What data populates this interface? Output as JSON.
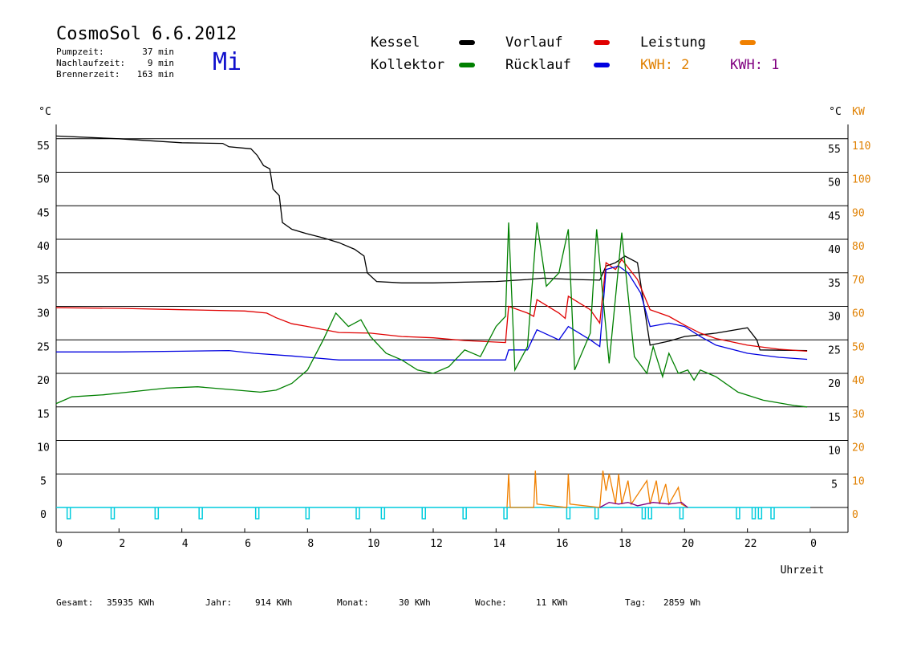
{
  "header": {
    "title": "CosmoSol 6.6.2012",
    "day": "Mi",
    "stats": [
      {
        "label": "Pumpzeit:",
        "value": "37 min"
      },
      {
        "label": "Nachlaufzeit:",
        "value": "9 min"
      },
      {
        "label": "Brennerzeit:",
        "value": "163 min"
      }
    ]
  },
  "legend": {
    "kessel": {
      "label": "Kessel",
      "color": "#000000"
    },
    "vorlauf": {
      "label": "Vorlauf",
      "color": "#e00000"
    },
    "leistung": {
      "label": "Leistung",
      "color": "#f08000"
    },
    "kollektor": {
      "label": "Kollektor",
      "color": "#008000"
    },
    "ruecklauf": {
      "label": "Rücklauf",
      "color": "#0000e0"
    },
    "kwh1": {
      "label": "KWH: 2",
      "color": "#e08000"
    },
    "kwh2": {
      "label": "KWH: 1",
      "color": "#800080"
    }
  },
  "footer": {
    "gesamt_label": "Gesamt:",
    "gesamt_value": "35935 KWh",
    "jahr_label": "Jahr:",
    "jahr_value": "914 KWh",
    "monat_label": "Monat:",
    "monat_value": "30 KWh",
    "woche_label": "Woche:",
    "woche_value": "11 KWh",
    "tag_label": "Tag:",
    "tag_value": "2859 Wh"
  },
  "chart_data": {
    "type": "line",
    "xlabel": "Uhrzeit",
    "ylabel_left": "°C",
    "ylabel_right_temp": "°C",
    "ylabel_right_power": "KW",
    "xlim": [
      0,
      24
    ],
    "ylim": [
      0,
      55
    ],
    "x_ticks": [
      0,
      2,
      4,
      6,
      8,
      10,
      12,
      14,
      16,
      18,
      20,
      22,
      24
    ],
    "x_tick_labels": [
      "0",
      "2",
      "4",
      "6",
      "8",
      "10",
      "12",
      "14",
      "16",
      "18",
      "20",
      "22",
      "0"
    ],
    "y_ticks_left": [
      0,
      5,
      10,
      15,
      20,
      25,
      30,
      35,
      40,
      45,
      50,
      55
    ],
    "y_ticks_right_temp": [
      5,
      10,
      15,
      20,
      25,
      30,
      35,
      40,
      45,
      50,
      55
    ],
    "y_ticks_right_power": [
      0,
      10,
      20,
      30,
      40,
      50,
      60,
      70,
      80,
      90,
      100,
      110
    ],
    "grid": true,
    "series": [
      {
        "key": "kessel",
        "name": "Kessel",
        "color": "#000000",
        "points": [
          [
            0,
            55.4
          ],
          [
            2,
            55.0
          ],
          [
            4,
            54.4
          ],
          [
            5.3,
            54.3
          ],
          [
            5.5,
            53.8
          ],
          [
            6.2,
            53.5
          ],
          [
            6.4,
            52.5
          ],
          [
            6.6,
            51.0
          ],
          [
            6.8,
            50.5
          ],
          [
            6.9,
            47.5
          ],
          [
            7.1,
            46.5
          ],
          [
            7.2,
            42.5
          ],
          [
            7.5,
            41.5
          ],
          [
            8,
            40.8
          ],
          [
            8.5,
            40.2
          ],
          [
            9,
            39.5
          ],
          [
            9.5,
            38.5
          ],
          [
            9.8,
            37.5
          ],
          [
            9.9,
            35.0
          ],
          [
            10.2,
            33.7
          ],
          [
            11,
            33.5
          ],
          [
            12,
            33.5
          ],
          [
            13,
            33.6
          ],
          [
            14,
            33.7
          ],
          [
            15,
            34.0
          ],
          [
            15.5,
            34.2
          ],
          [
            16.5,
            34.0
          ],
          [
            17.3,
            33.9
          ],
          [
            17.5,
            36.0
          ],
          [
            17.8,
            36.5
          ],
          [
            18.1,
            37.5
          ],
          [
            18.5,
            36.5
          ],
          [
            18.9,
            24.2
          ],
          [
            19.5,
            24.8
          ],
          [
            20,
            25.5
          ],
          [
            21,
            26.0
          ],
          [
            22,
            26.8
          ],
          [
            22.3,
            25.0
          ],
          [
            22.4,
            23.5
          ],
          [
            23.9,
            23.4
          ]
        ]
      },
      {
        "key": "vorlauf",
        "name": "Vorlauf",
        "color": "#e00000",
        "points": [
          [
            0,
            29.8
          ],
          [
            2,
            29.7
          ],
          [
            4,
            29.5
          ],
          [
            6,
            29.3
          ],
          [
            6.7,
            29.0
          ],
          [
            7,
            28.3
          ],
          [
            7.5,
            27.4
          ],
          [
            8,
            27.0
          ],
          [
            9,
            26.1
          ],
          [
            10,
            26.0
          ],
          [
            11,
            25.5
          ],
          [
            12,
            25.3
          ],
          [
            13,
            24.9
          ],
          [
            14.3,
            24.6
          ],
          [
            14.4,
            30.0
          ],
          [
            15,
            29.0
          ],
          [
            15.2,
            28.5
          ],
          [
            15.3,
            31.0
          ],
          [
            16,
            29.0
          ],
          [
            16.2,
            28.2
          ],
          [
            16.3,
            31.5
          ],
          [
            17,
            29.5
          ],
          [
            17.3,
            27.5
          ],
          [
            17.5,
            36.5
          ],
          [
            17.8,
            35.5
          ],
          [
            18,
            37.0
          ],
          [
            18.5,
            34.0
          ],
          [
            18.9,
            29.5
          ],
          [
            19.5,
            28.5
          ],
          [
            20,
            27.2
          ],
          [
            20.5,
            26.0
          ],
          [
            21,
            25.2
          ],
          [
            22,
            24.2
          ],
          [
            23,
            23.6
          ],
          [
            23.9,
            23.3
          ]
        ]
      },
      {
        "key": "ruecklauf",
        "name": "Rücklauf",
        "color": "#0000e0",
        "points": [
          [
            0,
            23.2
          ],
          [
            2,
            23.2
          ],
          [
            4,
            23.3
          ],
          [
            5.5,
            23.4
          ],
          [
            6.3,
            23.0
          ],
          [
            7.5,
            22.6
          ],
          [
            9,
            22.0
          ],
          [
            10,
            22.0
          ],
          [
            12,
            22.0
          ],
          [
            14.3,
            22.0
          ],
          [
            14.4,
            23.5
          ],
          [
            15,
            23.5
          ],
          [
            15.3,
            26.5
          ],
          [
            16,
            25.0
          ],
          [
            16.3,
            27.0
          ],
          [
            17,
            25.0
          ],
          [
            17.3,
            24.0
          ],
          [
            17.5,
            35.5
          ],
          [
            17.9,
            36.0
          ],
          [
            18.2,
            35.0
          ],
          [
            18.6,
            32.0
          ],
          [
            18.9,
            27.0
          ],
          [
            19.5,
            27.5
          ],
          [
            20,
            27.0
          ],
          [
            20.5,
            25.5
          ],
          [
            21,
            24.2
          ],
          [
            22,
            23.0
          ],
          [
            23,
            22.4
          ],
          [
            23.9,
            22.1
          ]
        ]
      },
      {
        "key": "kollektor",
        "name": "Kollektor",
        "color": "#008000",
        "points": [
          [
            0,
            15.5
          ],
          [
            0.5,
            16.5
          ],
          [
            1.5,
            16.8
          ],
          [
            2.5,
            17.3
          ],
          [
            3.5,
            17.8
          ],
          [
            4.5,
            18.0
          ],
          [
            5.5,
            17.6
          ],
          [
            6.5,
            17.2
          ],
          [
            7,
            17.5
          ],
          [
            7.5,
            18.5
          ],
          [
            8,
            20.5
          ],
          [
            8.5,
            25.0
          ],
          [
            8.9,
            29.0
          ],
          [
            9.3,
            27.0
          ],
          [
            9.7,
            28.0
          ],
          [
            10,
            25.5
          ],
          [
            10.5,
            23.0
          ],
          [
            11,
            22.0
          ],
          [
            11.5,
            20.5
          ],
          [
            12,
            20.0
          ],
          [
            12.5,
            21.0
          ],
          [
            13,
            23.5
          ],
          [
            13.5,
            22.5
          ],
          [
            14,
            27.0
          ],
          [
            14.3,
            28.5
          ],
          [
            14.4,
            42.5
          ],
          [
            14.6,
            20.5
          ],
          [
            15,
            24.0
          ],
          [
            15.3,
            42.5
          ],
          [
            15.6,
            33.0
          ],
          [
            16,
            35.0
          ],
          [
            16.3,
            41.5
          ],
          [
            16.5,
            20.5
          ],
          [
            17,
            26.0
          ],
          [
            17.2,
            41.5
          ],
          [
            17.6,
            21.5
          ],
          [
            18,
            41.0
          ],
          [
            18.4,
            22.5
          ],
          [
            18.8,
            20.0
          ],
          [
            19,
            24.0
          ],
          [
            19.3,
            19.5
          ],
          [
            19.5,
            23.0
          ],
          [
            19.8,
            20.0
          ],
          [
            20.1,
            20.5
          ],
          [
            20.3,
            19.0
          ],
          [
            20.5,
            20.5
          ],
          [
            21,
            19.5
          ],
          [
            21.7,
            17.2
          ],
          [
            22.5,
            16.0
          ],
          [
            23.5,
            15.2
          ],
          [
            23.9,
            15.0
          ]
        ]
      }
    ],
    "power_series": [
      {
        "key": "leistung",
        "name": "Leistung",
        "color": "#f08000",
        "points": [
          [
            14.35,
            0
          ],
          [
            14.4,
            10
          ],
          [
            14.45,
            0
          ],
          [
            15.2,
            0
          ],
          [
            15.25,
            11
          ],
          [
            15.3,
            1
          ],
          [
            16.25,
            0
          ],
          [
            16.3,
            10
          ],
          [
            16.35,
            1
          ],
          [
            17.3,
            0
          ],
          [
            17.4,
            11
          ],
          [
            17.5,
            5
          ],
          [
            17.6,
            10
          ],
          [
            17.8,
            1
          ],
          [
            17.9,
            10
          ],
          [
            18,
            1
          ],
          [
            18.2,
            8
          ],
          [
            18.3,
            1
          ],
          [
            18.8,
            8
          ],
          [
            18.9,
            1
          ],
          [
            19.1,
            8
          ],
          [
            19.2,
            1
          ],
          [
            19.4,
            7
          ],
          [
            19.5,
            1
          ],
          [
            19.8,
            6
          ],
          [
            19.9,
            1
          ],
          [
            20.1,
            0
          ]
        ]
      },
      {
        "key": "kwh",
        "name": "KWH",
        "color": "#800080",
        "points": [
          [
            17.3,
            0
          ],
          [
            17.6,
            1.5
          ],
          [
            17.9,
            1.0
          ],
          [
            18.2,
            1.5
          ],
          [
            18.5,
            0.5
          ],
          [
            19,
            1.5
          ],
          [
            19.5,
            1.0
          ],
          [
            19.9,
            1.5
          ],
          [
            20.1,
            0
          ]
        ]
      }
    ],
    "pump_markers_hours": [
      0.4,
      1.8,
      3.2,
      4.6,
      6.4,
      8.0,
      9.6,
      10.4,
      11.7,
      13.0,
      14.3,
      16.3,
      17.2,
      18.7,
      18.9,
      19.9,
      21.7,
      22.2,
      22.4,
      22.8
    ]
  }
}
